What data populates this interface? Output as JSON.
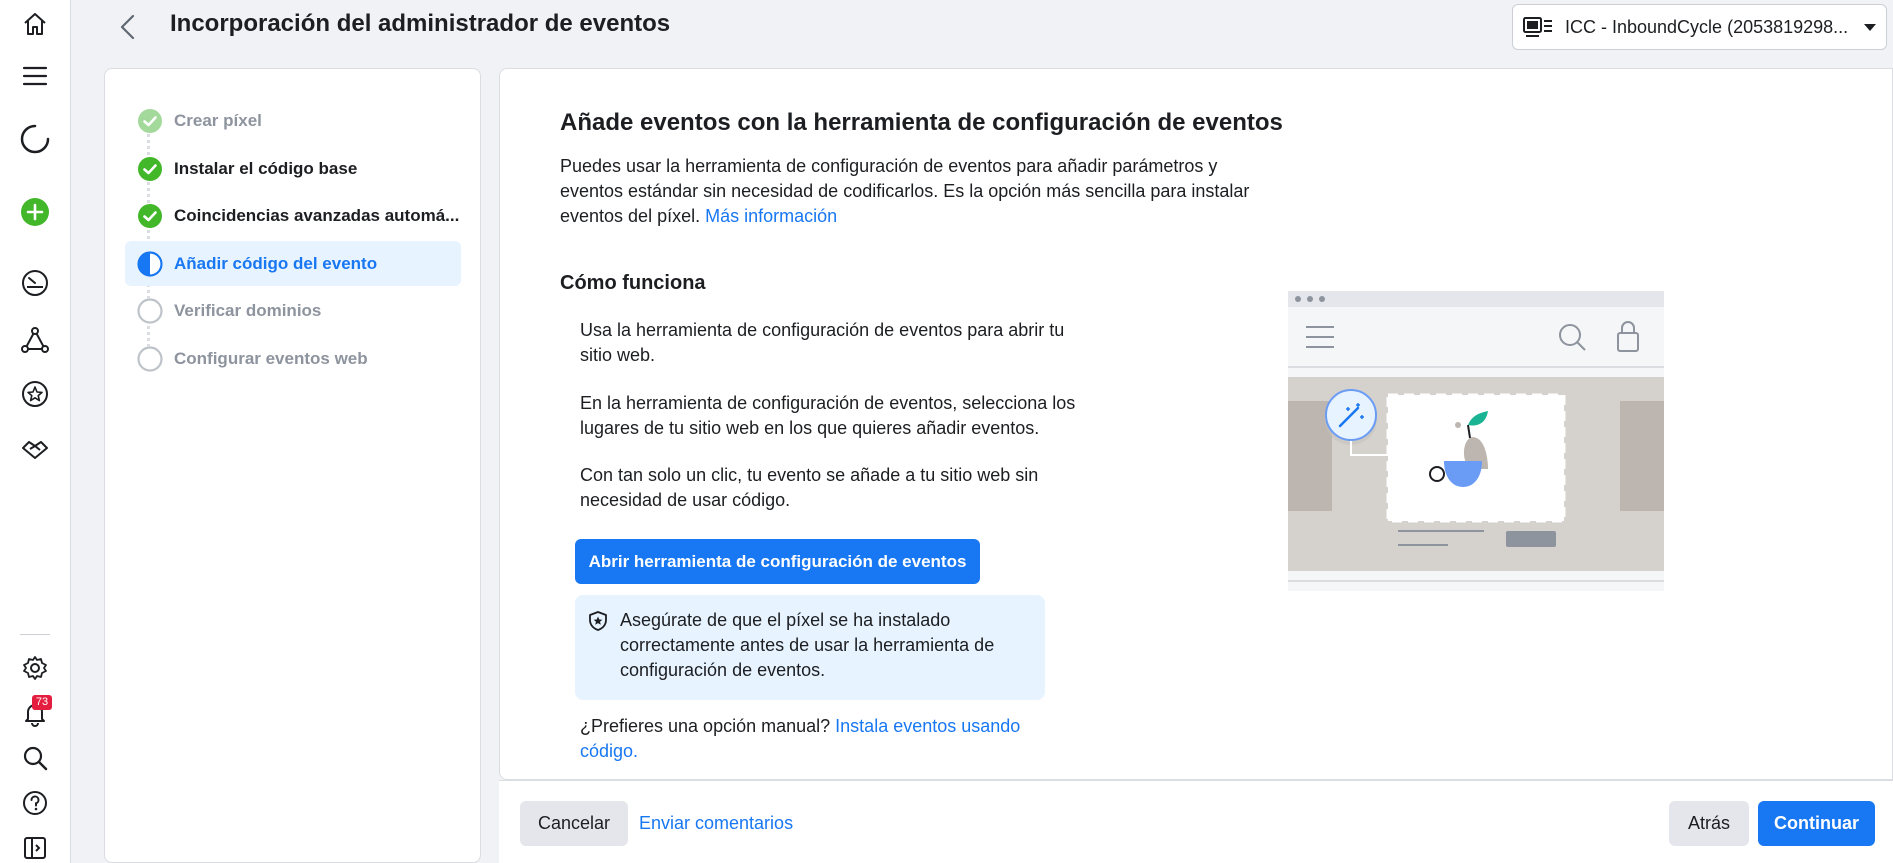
{
  "rail": {
    "icons": [
      "home-icon",
      "menu-icon",
      "loading-icon",
      "add-icon",
      "dashboard-icon",
      "network-icon",
      "star-icon",
      "handshake-icon",
      "settings-icon",
      "notifications-icon",
      "search-icon",
      "help-icon",
      "sidebar-toggle-icon"
    ],
    "notification_count": "73"
  },
  "header": {
    "title": "Incorporación del administrador de eventos",
    "account": "ICC - InboundCycle (2053819298..."
  },
  "steps": [
    {
      "label": "Crear píxel",
      "state": "completed-faded"
    },
    {
      "label": "Instalar el código base",
      "state": "completed"
    },
    {
      "label": "Coincidencias avanzadas automá...",
      "state": "completed"
    },
    {
      "label": "Añadir código del evento",
      "state": "active"
    },
    {
      "label": "Verificar dominios",
      "state": "pending"
    },
    {
      "label": "Configurar eventos web",
      "state": "pending"
    }
  ],
  "main": {
    "title": "Añade eventos con la herramienta de configuración de eventos",
    "intro": "Puedes usar la herramienta de configuración de eventos para añadir parámetros y eventos estándar sin necesidad de codificarlos. Es la opción más sencilla para instalar eventos del píxel.",
    "intro_link": "Más información",
    "how_title": "Cómo funciona",
    "how_steps": [
      "Usa la herramienta de configuración de eventos para abrir tu sitio web.",
      "En la herramienta de configuración de eventos, selecciona los lugares de tu sitio web en los que quieres añadir eventos.",
      "Con tan solo un clic, tu evento se añade a tu sitio web sin necesidad de usar código."
    ],
    "open_tool_button": "Abrir herramienta de configuración de eventos",
    "notice": "Asegúrate de que el píxel se ha instalado correctamente antes de usar la herramienta de configuración de eventos.",
    "manual_prompt": "¿Prefieres una opción manual?",
    "manual_link": "Instala eventos usando código."
  },
  "footer": {
    "cancel": "Cancelar",
    "feedback": "Enviar comentarios",
    "back": "Atrás",
    "continue": "Continuar"
  },
  "colors": {
    "accent": "#1877f2",
    "success": "#42b72a",
    "info_bg": "#e7f3ff"
  }
}
